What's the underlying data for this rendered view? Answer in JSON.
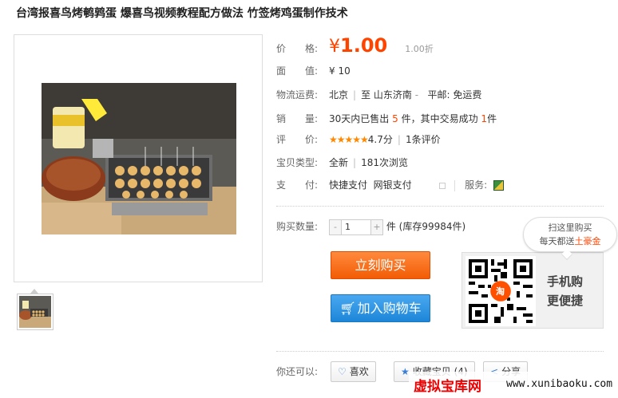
{
  "product": {
    "title": "台湾报喜鸟烤鹌鹑蛋 爆喜鸟视频教程配方做法 竹签烤鸡蛋制作技术"
  },
  "price": {
    "label": "价　　格:",
    "symbol": "¥",
    "value": "1.00",
    "discount": "1.00折"
  },
  "face_value": {
    "label": "面　　值:",
    "value": "¥ 10"
  },
  "shipping": {
    "label": "物流运费:",
    "from": "北京",
    "to_prefix": "至",
    "to": "山东济南",
    "dropdown_arrow": "-",
    "mail": "平邮: 免运费"
  },
  "sales": {
    "label": "销　　量:",
    "prefix": "30天内已售出",
    "sold": "5",
    "mid": "件，其中交易成功",
    "success": "1",
    "suffix": "件"
  },
  "rating": {
    "label": "评　　价:",
    "stars": "★★★★★",
    "score": "4.7分",
    "count": "1条评价"
  },
  "item_type": {
    "label": "宝贝类型:",
    "condition": "全新",
    "views": "181次浏览"
  },
  "payment": {
    "label": "支　　付:",
    "method1": "快捷支付",
    "method2": "网银支付",
    "service_label": "服务:"
  },
  "quantity": {
    "label": "购买数量:",
    "minus": "-",
    "value": "1",
    "plus": "+",
    "unit": "件",
    "stock": "(库存99984件)"
  },
  "buttons": {
    "buy_now": "立刻购买",
    "add_cart": "加入购物车"
  },
  "qr": {
    "bubble_line1": "扫这里购买",
    "bubble_line2_prefix": "每天都送",
    "bubble_line2_highlight": "土豪金",
    "line1": "手机购",
    "line2": "更便捷",
    "logo": "淘"
  },
  "actions": {
    "label": "你还可以:",
    "like": "喜欢",
    "favorite": "收藏宝贝 (4)",
    "share": "分享"
  },
  "watermark": {
    "cn": "虚拟宝库网",
    "url": "www.xunibaoku.com"
  },
  "colors": {
    "accent": "#ff4400",
    "buy_button": "#f25c05",
    "cart_button": "#1d86d8",
    "star": "#ff8800"
  }
}
